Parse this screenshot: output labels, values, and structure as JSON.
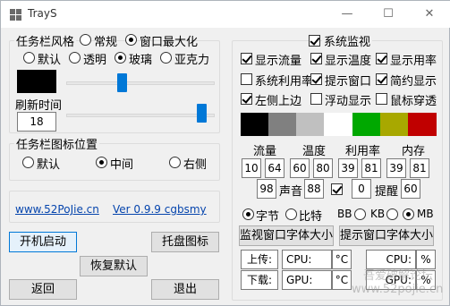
{
  "window": {
    "title": "TrayS",
    "minimize": "—",
    "maximize": "☐",
    "close": "✕"
  },
  "taskbar_style": {
    "legend": "任务栏风格",
    "mode_normal": "常规",
    "mode_max": "窗口最大化",
    "default": "默认",
    "transparent": "透明",
    "glass": "玻璃",
    "acrylic": "亚克力",
    "slider1_level": 0.5,
    "refresh_label": "刷新时间",
    "refresh_value": "18",
    "slider2_level": 1.0
  },
  "icon_position": {
    "legend": "任务栏图标位置",
    "default": "默认",
    "middle": "中间",
    "right": "右侧"
  },
  "links": {
    "site": "www.52PoJie.cn",
    "version": "Ver 0.9.9 cgbsmy"
  },
  "buttons": {
    "startup": "开机启动",
    "tray_icon": "托盘图标",
    "restore": "恢复默认",
    "back": "返回",
    "exit": "退出"
  },
  "monitor": {
    "legend": "系统监视",
    "show_traffic": "显示流量",
    "show_temp": "显示温度",
    "show_usage": "显示用率",
    "sys_usage": "系统利用率",
    "tip_window": "提示窗口",
    "simple_display": "简约显示",
    "left_top": "左侧上边",
    "float_display": "浮动显示",
    "mouse_through": "鼠标穿透",
    "colors": [
      "#000000",
      "#808080",
      "#c0c0c0",
      "#ffffff",
      "#00a800",
      "#a8a800",
      "#c00000"
    ],
    "headers": {
      "traffic": "流量",
      "temp": "温度",
      "usage": "利用率",
      "memory": "内存"
    },
    "values": [
      "10",
      "64",
      "60",
      "80",
      "39",
      "81",
      "39",
      "81"
    ],
    "sound_value": "98",
    "sound_label": "声音",
    "sound_value2": "88",
    "remind_value": "0",
    "remind_label": "提醒",
    "remind_value2": "60",
    "unit_byte": "字节",
    "unit_bit": "比特",
    "bb": "BB",
    "kb": "KB",
    "mb": "MB",
    "font_monitor": "监视窗口字体大小",
    "font_tip": "提示窗口字体大小",
    "upload": "上传:",
    "download": "下载:",
    "cpu": "CPU:",
    "gpu": "GPU:",
    "celsius": "°C",
    "percent": "%"
  },
  "watermark": {
    "line1": "吾爱破解论坛",
    "line2": "www.52pojie.cn"
  }
}
